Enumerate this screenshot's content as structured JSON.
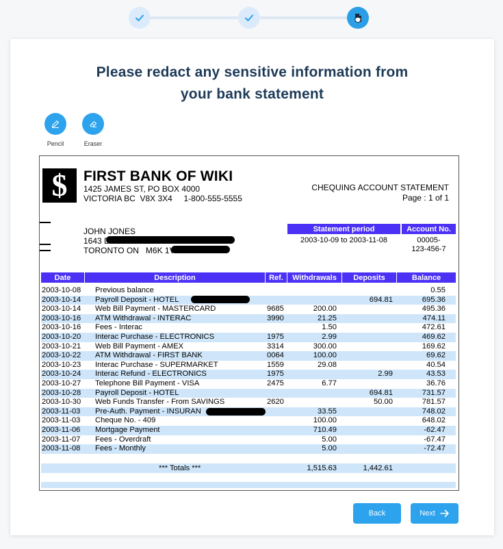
{
  "stepper": {
    "steps": [
      {
        "state": "complete",
        "icon": "check-icon"
      },
      {
        "state": "complete",
        "icon": "check-icon"
      },
      {
        "state": "active",
        "icon": "shield-redact-icon"
      }
    ]
  },
  "heading": {
    "line1": "Please redact any sensitive information from",
    "line2": "your bank statement"
  },
  "tools": [
    {
      "label": "Pencil",
      "icon": "pencil-icon"
    },
    {
      "label": "Eraser",
      "icon": "eraser-icon"
    }
  ],
  "statement": {
    "logo_glyph": "$",
    "bank_name": "FIRST BANK OF WIKI",
    "address_line1": "1425 JAMES ST, PO BOX 4000",
    "address_line2": "VICTORIA BC  V8X 3X4     1-800-555-5555",
    "doc_type": "CHEQUING ACCOUNT STATEMENT",
    "page": "Page : 1 of 1",
    "customer_name": "JOHN JONES",
    "customer_addr1": "1643 D",
    "customer_addr2": "TORONTO ON   M6K 1V",
    "period_header": "Statement period",
    "period_value": "2003-10-09 to 2003-11-08",
    "account_header": "Account No.",
    "account_value_line1": "00005-",
    "account_value_line2": "123-456-7",
    "columns": [
      "Date",
      "Description",
      "Ref.",
      "Withdrawals",
      "Deposits",
      "Balance"
    ],
    "rows": [
      {
        "date": "2003-10-08",
        "desc": "Previous balance",
        "ref": "",
        "wd": "",
        "dep": "",
        "bal": "0.55"
      },
      {
        "date": "2003-10-14",
        "desc": "Payroll Deposit - HOTEL",
        "ref": "",
        "wd": "",
        "dep": "694.81",
        "bal": "695.36"
      },
      {
        "date": "2003-10-14",
        "desc": "Web Bill Payment - MASTERCARD",
        "ref": "9685",
        "wd": "200.00",
        "dep": "",
        "bal": "495.36"
      },
      {
        "date": "2003-10-16",
        "desc": "ATM Withdrawal - INTERAC",
        "ref": "3990",
        "wd": "21.25",
        "dep": "",
        "bal": "474.11"
      },
      {
        "date": "2003-10-16",
        "desc": "Fees - Interac",
        "ref": "",
        "wd": "1.50",
        "dep": "",
        "bal": "472.61"
      },
      {
        "date": "2003-10-20",
        "desc": "Interac Purchase - ELECTRONICS",
        "ref": "1975",
        "wd": "2.99",
        "dep": "",
        "bal": "469.62"
      },
      {
        "date": "2003-10-21",
        "desc": "Web Bill Payment - AMEX",
        "ref": "3314",
        "wd": "300.00",
        "dep": "",
        "bal": "169.62"
      },
      {
        "date": "2003-10-22",
        "desc": "ATM Withdrawal - FIRST BANK",
        "ref": "0064",
        "wd": "100.00",
        "dep": "",
        "bal": "69.62"
      },
      {
        "date": "2003-10-23",
        "desc": "Interac Purchase - SUPERMARKET",
        "ref": "1559",
        "wd": "29.08",
        "dep": "",
        "bal": "40.54"
      },
      {
        "date": "2003-10-24",
        "desc": "Interac Refund - ELECTRONICS",
        "ref": "1975",
        "wd": "",
        "dep": "2.99",
        "bal": "43.53"
      },
      {
        "date": "2003-10-27",
        "desc": "Telephone Bill Payment - VISA",
        "ref": "2475",
        "wd": "6.77",
        "dep": "",
        "bal": "36.76"
      },
      {
        "date": "2003-10-28",
        "desc": "Payroll Deposit - HOTEL",
        "ref": "",
        "wd": "",
        "dep": "694.81",
        "bal": "731.57"
      },
      {
        "date": "2003-10-30",
        "desc": "Web Funds Transfer - From  SAVINGS",
        "ref": "2620",
        "wd": "",
        "dep": "50.00",
        "bal": "781.57"
      },
      {
        "date": "2003-11-03",
        "desc": "Pre-Auth. Payment - INSURAN",
        "ref": "",
        "wd": "33.55",
        "dep": "",
        "bal": "748.02"
      },
      {
        "date": "2003-11-03",
        "desc": "Cheque No. - 409",
        "ref": "",
        "wd": "100.00",
        "dep": "",
        "bal": "648.02"
      },
      {
        "date": "2003-11-06",
        "desc": "Mortgage Payment",
        "ref": "",
        "wd": "710.49",
        "dep": "",
        "bal": "-62.47"
      },
      {
        "date": "2003-11-07",
        "desc": "Fees - Overdraft",
        "ref": "",
        "wd": "5.00",
        "dep": "",
        "bal": "-67.47"
      },
      {
        "date": "2003-11-08",
        "desc": "Fees - Monthly",
        "ref": "",
        "wd": "5.00",
        "dep": "",
        "bal": "-72.47"
      }
    ],
    "totals_label": "*** Totals ***",
    "totals_withdrawals": "1,515.63",
    "totals_deposits": "1,442.61"
  },
  "buttons": {
    "back": "Back",
    "next": "Next",
    "next_icon": "arrow-right-icon"
  },
  "colors": {
    "accent": "#2ca3ec",
    "table_header": "#4b31f6",
    "row_stripe": "#cfe6fa",
    "heading": "#1d3a57"
  }
}
